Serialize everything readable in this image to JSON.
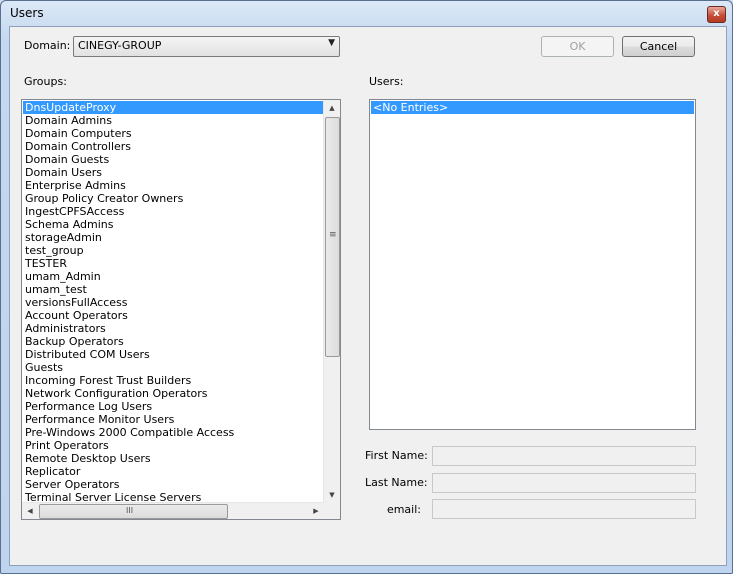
{
  "window": {
    "title": "Users",
    "close_glyph": "x"
  },
  "domain": {
    "label": "Domain:",
    "value": "CINEGY-GROUP",
    "arrow": "▼"
  },
  "buttons": {
    "ok": "OK",
    "cancel": "Cancel"
  },
  "groups": {
    "label": "Groups:",
    "selected_index": 0,
    "items": [
      "DnsUpdateProxy",
      "Domain Admins",
      "Domain Computers",
      "Domain Controllers",
      "Domain Guests",
      "Domain Users",
      "Enterprise Admins",
      "Group Policy Creator Owners",
      "IngestCPFSAccess",
      "Schema Admins",
      "storageAdmin",
      "test_group",
      "TESTER",
      "umam_Admin",
      "umam_test",
      "versionsFullAccess",
      "Account Operators",
      "Administrators",
      "Backup Operators",
      "Distributed COM Users",
      "Guests",
      "Incoming Forest Trust Builders",
      "Network Configuration Operators",
      "Performance Log Users",
      "Performance Monitor Users",
      "Pre-Windows 2000 Compatible Access",
      "Print Operators",
      "Remote Desktop Users",
      "Replicator",
      "Server Operators",
      "Terminal Server License Servers"
    ]
  },
  "users": {
    "label": "Users:",
    "items": [
      "<No Entries>"
    ]
  },
  "details": {
    "first_name_label": "First Name:",
    "last_name_label": "Last Name:",
    "email_label": "email:",
    "first_name": "",
    "last_name": "",
    "email": ""
  },
  "scroll": {
    "up": "▲",
    "down": "▼",
    "left": "◀",
    "right": "▶",
    "vgrip": "≡",
    "hgrip": "III"
  }
}
